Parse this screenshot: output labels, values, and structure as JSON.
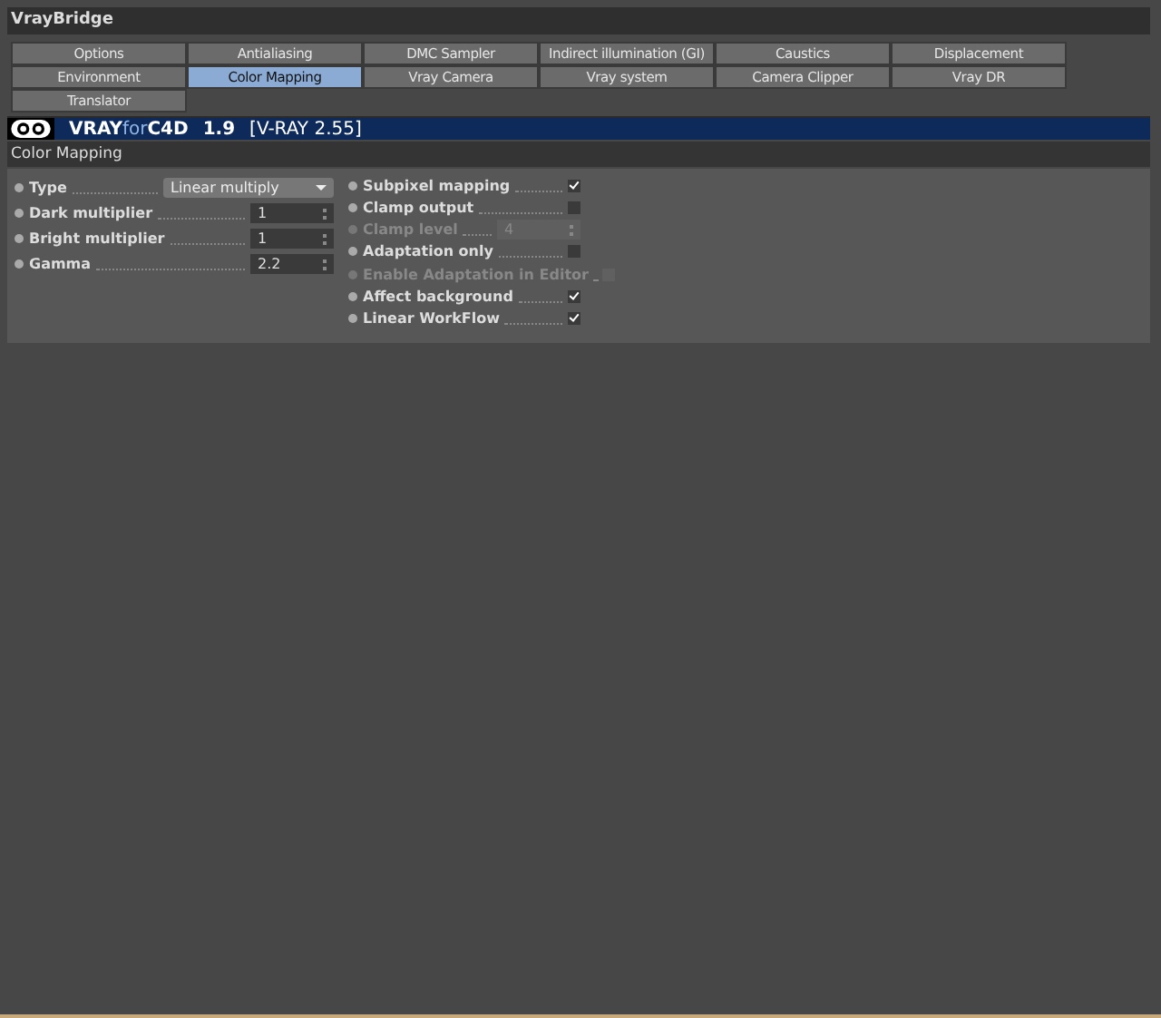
{
  "window": {
    "title": "VrayBridge"
  },
  "tabs": [
    {
      "label": "Options",
      "selected": false
    },
    {
      "label": "Antialiasing",
      "selected": false
    },
    {
      "label": "DMC Sampler",
      "selected": false
    },
    {
      "label": "Indirect illumination (GI)",
      "selected": false
    },
    {
      "label": "Caustics",
      "selected": false
    },
    {
      "label": "Displacement",
      "selected": false
    },
    {
      "label": "Environment",
      "selected": false
    },
    {
      "label": "Color Mapping",
      "selected": true
    },
    {
      "label": "Vray Camera",
      "selected": false
    },
    {
      "label": "Vray system",
      "selected": false
    },
    {
      "label": "Camera Clipper",
      "selected": false
    },
    {
      "label": "Vray DR",
      "selected": false
    },
    {
      "label": "Translator",
      "selected": false
    }
  ],
  "banner": {
    "brand_bold": "VRAY",
    "brand_light": "for",
    "brand_end": "C4D",
    "version": "1.9",
    "engine": "[V-RAY 2.55]"
  },
  "section": {
    "title": "Color Mapping"
  },
  "left_params": [
    {
      "kind": "dropdown",
      "label": "Type",
      "value": "Linear multiply",
      "disabled": false
    },
    {
      "kind": "number",
      "label": "Dark multiplier",
      "value": "1",
      "disabled": false
    },
    {
      "kind": "number",
      "label": "Bright multiplier",
      "value": "1",
      "disabled": false
    },
    {
      "kind": "number",
      "label": "Gamma",
      "value": "2.2",
      "disabled": false
    }
  ],
  "right_params": [
    {
      "kind": "checkbox",
      "label": "Subpixel mapping",
      "checked": true,
      "disabled": false
    },
    {
      "kind": "checkbox",
      "label": "Clamp output",
      "checked": false,
      "disabled": false
    },
    {
      "kind": "number",
      "label": "Clamp level",
      "value": "4",
      "disabled": true
    },
    {
      "kind": "checkbox",
      "label": "Adaptation only",
      "checked": false,
      "disabled": false
    },
    {
      "kind": "checkbox",
      "label": "Enable Adaptation in Editor",
      "checked": false,
      "disabled": true
    },
    {
      "kind": "checkbox",
      "label": "Affect background",
      "checked": true,
      "disabled": false
    },
    {
      "kind": "checkbox",
      "label": "Linear WorkFlow",
      "checked": true,
      "disabled": false
    }
  ]
}
